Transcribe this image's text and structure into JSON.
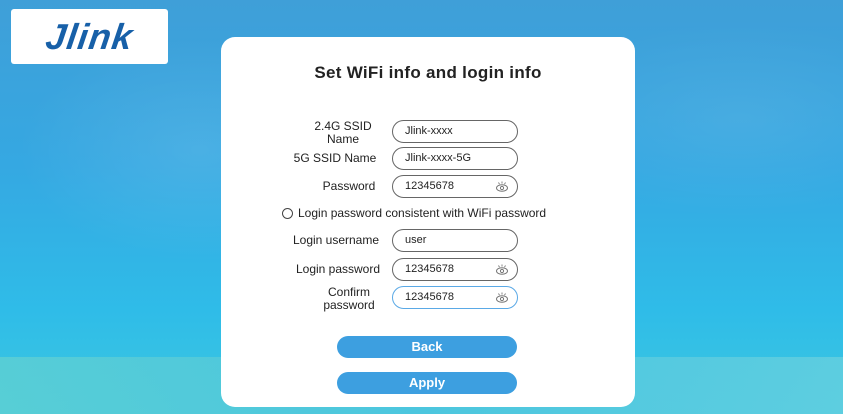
{
  "brand": {
    "logo_text": "Jlink"
  },
  "page": {
    "title": "Set WiFi info and login info"
  },
  "form": {
    "ssid_24": {
      "label_line1": "2.4G SSID",
      "label_line2": "Name",
      "value": "Jlink-xxxx"
    },
    "ssid_5": {
      "label": "5G SSID Name",
      "value": "Jlink-xxxx-5G"
    },
    "wifi_password": {
      "label": "Password",
      "value": "12345678",
      "icon": "eye-icon"
    },
    "consistent_option": {
      "label": "Login  password consistent with WiFi password",
      "checked": false
    },
    "login_username": {
      "label": "Login  username",
      "value": "user"
    },
    "login_password": {
      "label": "Login  password",
      "value": "12345678",
      "icon": "eye-icon"
    },
    "confirm_password": {
      "label_line1": "Confirm",
      "label_line2": "password",
      "value": "12345678",
      "icon": "eye-icon"
    }
  },
  "actions": {
    "back_label": "Back",
    "apply_label": "Apply"
  },
  "colors": {
    "button": "#3d9fe0",
    "logo": "#1760a8",
    "focus_border": "#5aa9e6"
  }
}
